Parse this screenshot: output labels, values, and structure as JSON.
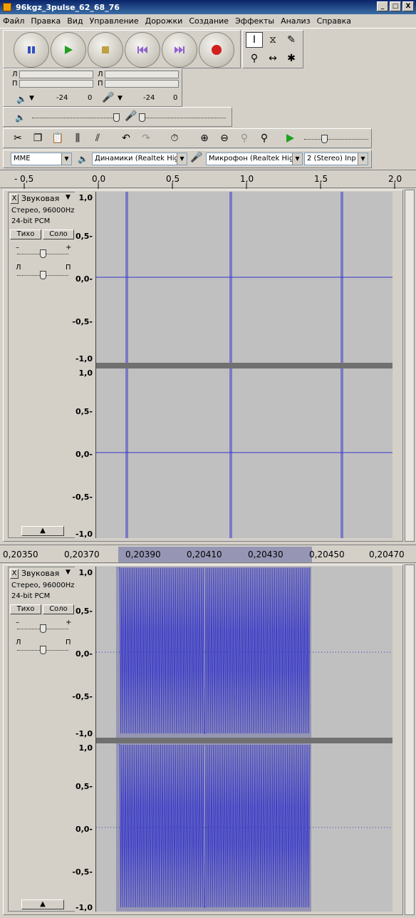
{
  "window": {
    "title": "96kgz_3pulse_62_68_76",
    "min": "_",
    "max": "□",
    "close": "X"
  },
  "menu": [
    "Файл",
    "Правка",
    "Вид",
    "Управление",
    "Дорожки",
    "Создание",
    "Эффекты",
    "Анализ",
    "Справка"
  ],
  "meters": {
    "left_ch": "Л",
    "right_ch": "П",
    "play_scale": [
      "-24",
      "0"
    ],
    "rec_scale": [
      "-24",
      "0"
    ]
  },
  "devices": {
    "host": "MME",
    "output": "Динамики (Realtek High",
    "input": "Микрофон (Realtek High",
    "channels": "2 (Stereo) Inp"
  },
  "ruler_top": [
    "- 0,5",
    "0,0",
    "0,5",
    "1,0",
    "1,5",
    "2,0"
  ],
  "ruler_bottom": [
    "0,20350",
    "0,20370",
    "0,20390",
    "0,20410",
    "0,20430",
    "0,20450",
    "0,20470"
  ],
  "track": {
    "name": "Звуковая",
    "format1": "Стерео, 96000Hz",
    "format2": "24-bit PCM",
    "mute": "Тихо",
    "solo": "Соло",
    "gain_minus": "–",
    "gain_plus": "+",
    "pan_left": "Л",
    "pan_right": "П",
    "collapse": "▲",
    "close": "X"
  },
  "y_ticks": [
    "1,0",
    "0,5-",
    "0,0-",
    "-0,5-",
    "-1,0"
  ],
  "colors": {
    "wave": "#3333cc",
    "selection": "#9696b4",
    "bg": "#c0c0c0"
  }
}
